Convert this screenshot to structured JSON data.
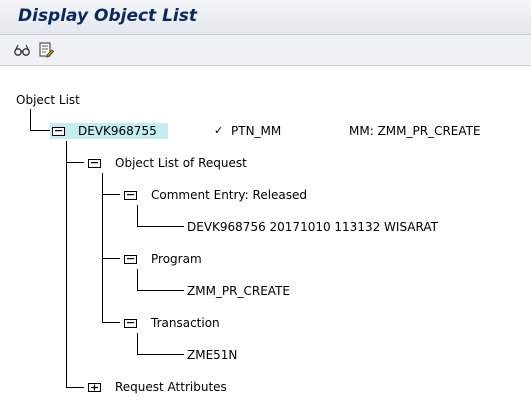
{
  "window": {
    "title": "Display Object List"
  },
  "toolbar": {
    "buttons": [
      {
        "name": "glasses-icon",
        "tooltip": "Display"
      },
      {
        "name": "document-edit-icon",
        "tooltip": "Details"
      }
    ]
  },
  "tree": {
    "root_label": "Object List",
    "request": {
      "number": "DEVK968755",
      "status_icon": "check-icon",
      "owner": "PTN_MM",
      "description": "MM: ZMM_PR_CREATE"
    },
    "object_list_label": "Object List of Request",
    "comment_entry": {
      "label": "Comment Entry: Released",
      "value": "DEVK968756 20171010 113132 WISARAT"
    },
    "program": {
      "label": "Program",
      "value": "ZMM_PR_CREATE"
    },
    "transaction": {
      "label": "Transaction",
      "value": "ZME51N"
    },
    "request_attributes_label": "Request Attributes"
  }
}
